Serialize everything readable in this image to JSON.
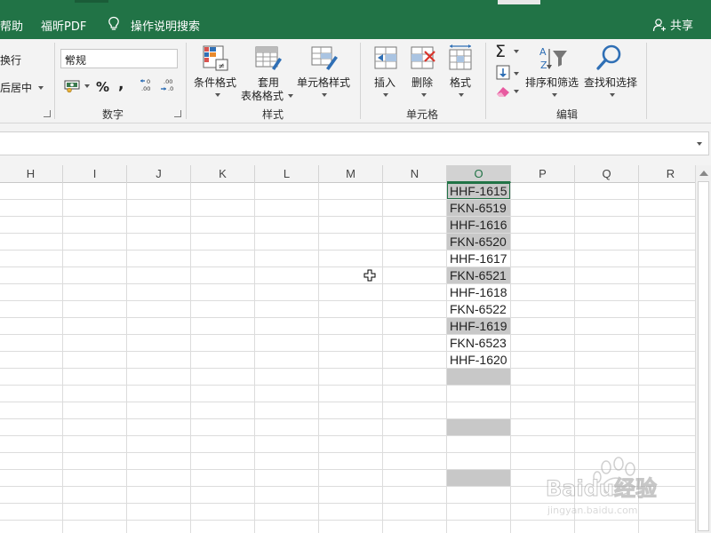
{
  "tabs": {
    "help": "帮助",
    "foxit_pdf": "福昕PDF",
    "tell_me": "操作说明搜索",
    "share": "共享"
  },
  "ribbon": {
    "alignment": {
      "wrap_text": "换行",
      "merge_center": "后居中"
    },
    "number": {
      "format_value": "常规",
      "percent": "%",
      "comma": ",",
      "group_label": "数字"
    },
    "styles": {
      "conditional_formatting": "条件格式",
      "format_as_table_line1": "套用",
      "format_as_table_line2": "表格格式",
      "cell_styles": "单元格样式",
      "group_label": "样式"
    },
    "cells": {
      "insert": "插入",
      "delete": "删除",
      "format": "格式",
      "group_label": "单元格"
    },
    "editing": {
      "sort_filter": "排序和筛选",
      "find_select": "查找和选择",
      "group_label": "编辑"
    }
  },
  "columns": [
    "H",
    "I",
    "J",
    "K",
    "L",
    "M",
    "N",
    "O",
    "P",
    "Q",
    "R"
  ],
  "selected_column": "O",
  "column_o_cells": [
    {
      "text": "HHF-1615",
      "highlight": true,
      "active": true
    },
    {
      "text": "FKN-6519",
      "highlight": true
    },
    {
      "text": "HHF-1616",
      "highlight": true
    },
    {
      "text": "FKN-6520",
      "highlight": true
    },
    {
      "text": "HHF-1617",
      "highlight": false
    },
    {
      "text": "FKN-6521",
      "highlight": true
    },
    {
      "text": "HHF-1618",
      "highlight": false
    },
    {
      "text": "FKN-6522",
      "highlight": false
    },
    {
      "text": "HHF-1619",
      "highlight": true
    },
    {
      "text": "FKN-6523",
      "highlight": false
    },
    {
      "text": "HHF-1620",
      "highlight": false
    },
    {
      "text": "",
      "highlight": true
    },
    {
      "text": "",
      "highlight": false
    },
    {
      "text": "",
      "highlight": false
    },
    {
      "text": "",
      "highlight": true
    },
    {
      "text": "",
      "highlight": false
    },
    {
      "text": "",
      "highlight": false
    },
    {
      "text": "",
      "highlight": true
    }
  ],
  "watermark": {
    "text_main": "Baidu经验",
    "text_sub": "jingyan.baidu.com"
  },
  "colors": {
    "excel_green": "#217346",
    "highlight_gray": "#c8c8c8"
  }
}
